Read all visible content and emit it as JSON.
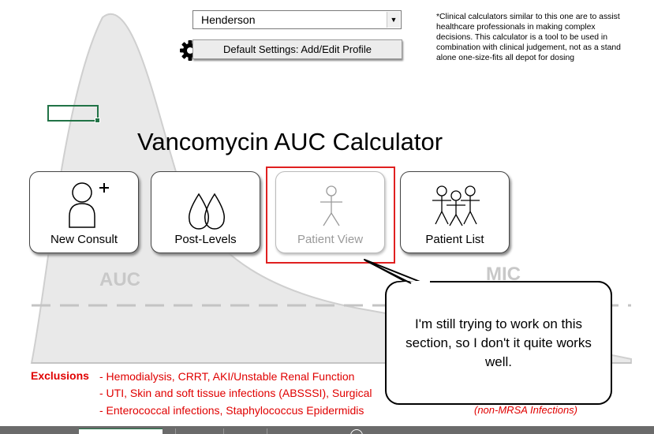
{
  "profile_select": {
    "value": "Henderson"
  },
  "settings_button": {
    "label": "Default Settings: Add/Edit Profile"
  },
  "disclaimer": "*Clinical calculators similar to this one are to assist healthcare professionals in making complex decisions. This calculator is a tool to be used in combination with clinical judgement, not as a stand alone one-size-fits all depot for dosing",
  "title": "Vancomycin AUC Calculator",
  "background_labels": {
    "auc": "AUC",
    "mic": "MIC"
  },
  "cards": [
    {
      "label": "New Consult",
      "icon": "add-person-icon",
      "enabled": true
    },
    {
      "label": "Post-Levels",
      "icon": "drops-icon",
      "enabled": true
    },
    {
      "label": "Patient View",
      "icon": "stick-figure-icon",
      "enabled": false
    },
    {
      "label": "Patient List",
      "icon": "group-icon",
      "enabled": true
    }
  ],
  "callout": "I'm still trying to work on this section, so I don't it quite works well.",
  "exclusions": {
    "label": "Exclusions",
    "lines": [
      "- Hemodialysis, CRRT, AKI/Unstable Renal Function",
      "- UTI, Skin and soft tissue infections (ABSSSI), Surgical",
      "- Enterococcal infections, Staphylococcus Epidermidis"
    ],
    "note": "(non-MRSA Infections)"
  },
  "colors": {
    "accent_red": "#e00000",
    "frame_red": "#e02020",
    "excel_green": "#217346"
  }
}
